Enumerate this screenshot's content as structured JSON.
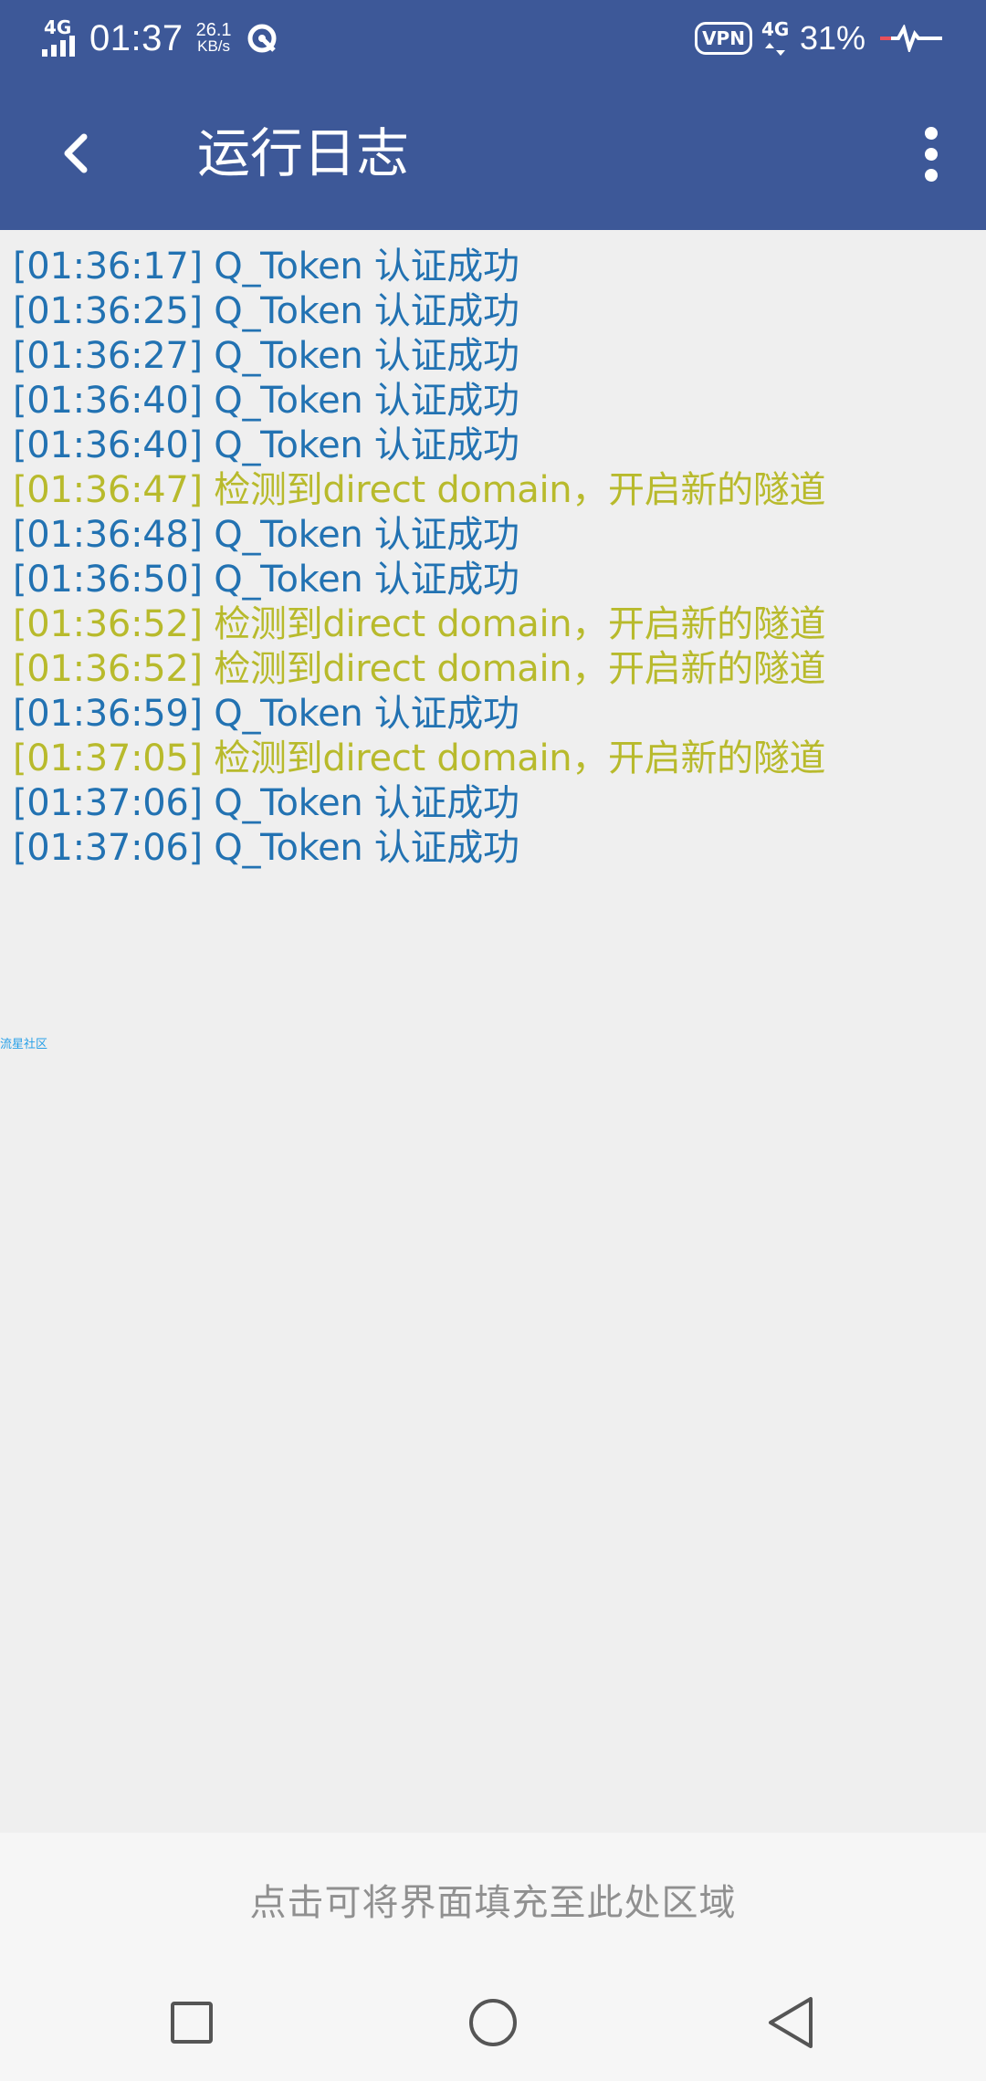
{
  "status": {
    "network": "4G",
    "time": "01:37",
    "speed_value": "26.1",
    "speed_unit": "KB/s",
    "vpn": "VPN",
    "network2": "4G",
    "battery": "31%"
  },
  "appbar": {
    "title": "运行日志"
  },
  "log": {
    "normal_color": "#2272b2",
    "event_color": "#b8ba2c",
    "lines": [
      {
        "text": "[01:36:17] Q_Token 认证成功",
        "kind": "normal"
      },
      {
        "text": "[01:36:25] Q_Token 认证成功",
        "kind": "normal"
      },
      {
        "text": "[01:36:27] Q_Token 认证成功",
        "kind": "normal"
      },
      {
        "text": "[01:36:40] Q_Token 认证成功",
        "kind": "normal"
      },
      {
        "text": "[01:36:40] Q_Token 认证成功",
        "kind": "normal"
      },
      {
        "text": "[01:36:47] 检测到direct domain，开启新的隧道",
        "kind": "event"
      },
      {
        "text": "[01:36:48] Q_Token 认证成功",
        "kind": "normal"
      },
      {
        "text": "[01:36:50] Q_Token 认证成功",
        "kind": "normal"
      },
      {
        "text": "[01:36:52] 检测到direct domain，开启新的隧道",
        "kind": "event"
      },
      {
        "text": "[01:36:52] 检测到direct domain，开启新的隧道",
        "kind": "event"
      },
      {
        "text": "[01:36:59] Q_Token 认证成功",
        "kind": "normal"
      },
      {
        "text": "[01:37:05] 检测到direct domain，开启新的隧道",
        "kind": "event"
      },
      {
        "text": "[01:37:06] Q_Token 认证成功",
        "kind": "normal"
      },
      {
        "text": "[01:37:06] Q_Token 认证成功",
        "kind": "normal"
      }
    ]
  },
  "watermark": "流星社区",
  "bottom": {
    "fill_hint": "点击可将界面填充至此处区域"
  },
  "icons": {
    "back": "back-arrow-icon",
    "more": "more-vert-icon",
    "recents": "recents-square-icon",
    "home": "home-circle-icon",
    "nav_back": "back-triangle-icon"
  }
}
